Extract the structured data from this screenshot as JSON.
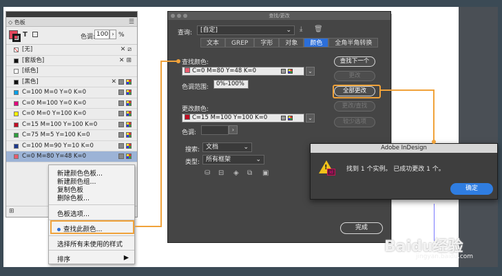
{
  "swatches": {
    "tab_label": "◇ 色板",
    "tint_label": "色调:",
    "tint_value": "100",
    "tint_pct": "%",
    "t_glyph": "T",
    "rows": [
      {
        "name": "[无]",
        "chip": "none",
        "icons": "x-none"
      },
      {
        "name": "[套版色]",
        "chip": "#111111",
        "icons": "x-reg"
      },
      {
        "name": "[纸色]",
        "chip": "#ffffff",
        "icons": ""
      },
      {
        "name": "[黑色]",
        "chip": "#111111",
        "icons": "x-gm"
      },
      {
        "name": "C=100 M=0 Y=0 K=0",
        "chip": "#00a0e9",
        "icons": "gm"
      },
      {
        "name": "C=0 M=100 Y=0 K=0",
        "chip": "#e4007f",
        "icons": "gm"
      },
      {
        "name": "C=0 M=0 Y=100 K=0",
        "chip": "#fff100",
        "icons": "gm"
      },
      {
        "name": "C=15 M=100 Y=100 K=0",
        "chip": "#c30d23",
        "icons": "gm"
      },
      {
        "name": "C=75 M=5 Y=100 K=0",
        "chip": "#2e9e3d",
        "icons": "gm"
      },
      {
        "name": "C=100 M=90 Y=10 K=0",
        "chip": "#1d3a8f",
        "icons": "gm"
      },
      {
        "name": "C=0 M=80 Y=48 K=0",
        "chip": "#e95a6e",
        "icons": "gm",
        "selected": true
      }
    ]
  },
  "context_menu": {
    "items": [
      "新建颜色色板...",
      "新建颜色组...",
      "复制色板",
      "删除色板..."
    ],
    "swatch_options": "色板选项...",
    "find_color": "查找此颜色...",
    "select_unused": "选择所有未使用的样式",
    "sort": "排序",
    "sort_arrow": "▶"
  },
  "find_change": {
    "title": "查找/更改",
    "query_label": "查询:",
    "query_value": "[自定]",
    "tabs": [
      "文本",
      "GREP",
      "字形",
      "对象",
      "颜色",
      "全角半角转换"
    ],
    "active_tab": "颜色",
    "find_color_label": "查找颜色:",
    "find_color_value": "C=0 M=80 Y=48 K=0",
    "find_color_chip": "#e95a6e",
    "tint_range_label": "色调范围:",
    "tint_range_value": "0%-100%",
    "change_color_label": "更改颜色:",
    "change_color_value": "C=15 M=100 Y=100 K=0",
    "change_color_chip": "#c30d23",
    "tint_label": "色调:",
    "search_label": "搜索:",
    "search_value": "文档",
    "type_label": "类型:",
    "type_value": "所有框架",
    "buttons": {
      "find_next": "查找下一个",
      "change": "更改",
      "change_all": "全部更改",
      "change_find": "更改/查找",
      "fewer_options": "较少选项",
      "done": "完成"
    }
  },
  "alert": {
    "title": "Adobe InDesign",
    "message": "找到 1 个实例。 已成功更改 1 个。",
    "ok": "确定",
    "icon_badge": "Id",
    "icon_ex": "!"
  },
  "watermark": {
    "brand": "Baidu经验",
    "url": "jingyan.baidu.com"
  }
}
